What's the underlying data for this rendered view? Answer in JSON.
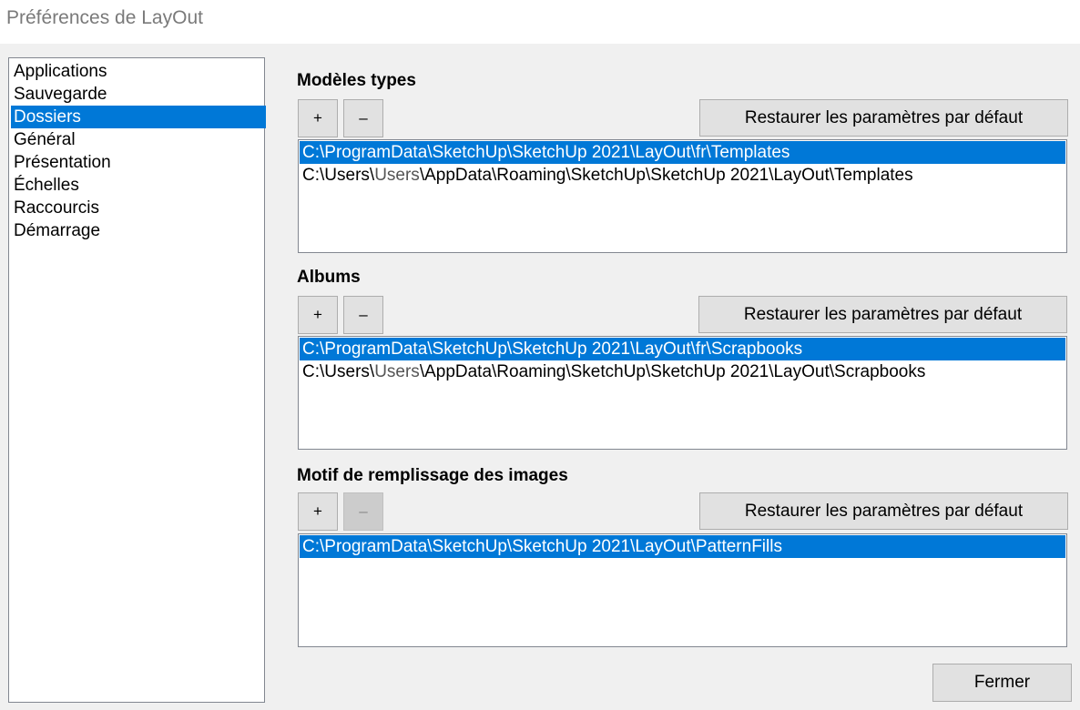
{
  "window": {
    "title": "Préférences de LayOut"
  },
  "sidebar": {
    "items": [
      {
        "label": "Applications"
      },
      {
        "label": "Sauvegarde"
      },
      {
        "label": "Dossiers",
        "selected": true
      },
      {
        "label": "Général"
      },
      {
        "label": "Présentation"
      },
      {
        "label": "Échelles"
      },
      {
        "label": "Raccourcis"
      },
      {
        "label": "Démarrage"
      }
    ]
  },
  "sections": {
    "templates": {
      "title": "Modèles types",
      "add_label": "+",
      "remove_label": "–",
      "restore_label": "Restaurer les paramètres par défaut",
      "rows": [
        {
          "pre": "C:\\ProgramData\\SketchUp\\SketchUp 2021\\LayOut\\fr\\Templates",
          "user": "",
          "post": ""
        },
        {
          "pre": "C:\\Users\\",
          "user": "Users",
          "post": "\\AppData\\Roaming\\SketchUp\\SketchUp 2021\\LayOut\\Templates"
        }
      ]
    },
    "scrapbooks": {
      "title": "Albums",
      "add_label": "+",
      "remove_label": "–",
      "restore_label": "Restaurer les paramètres par défaut",
      "rows": [
        {
          "pre": "C:\\ProgramData\\SketchUp\\SketchUp 2021\\LayOut\\fr\\Scrapbooks",
          "user": "",
          "post": ""
        },
        {
          "pre": "C:\\Users\\",
          "user": "Users",
          "post": "\\AppData\\Roaming\\SketchUp\\SketchUp 2021\\LayOut\\Scrapbooks"
        }
      ]
    },
    "patterns": {
      "title": "Motif de remplissage des images",
      "add_label": "+",
      "remove_label": "–",
      "restore_label": "Restaurer les paramètres par défaut",
      "rows": [
        {
          "pre": "C:\\ProgramData\\SketchUp\\SketchUp 2021\\LayOut\\PatternFills",
          "user": "",
          "post": ""
        }
      ]
    }
  },
  "footer": {
    "close_label": "Fermer"
  },
  "colors": {
    "selection": "#0078d7",
    "background": "#f0f0f0",
    "title_text": "#7a7a7a"
  }
}
